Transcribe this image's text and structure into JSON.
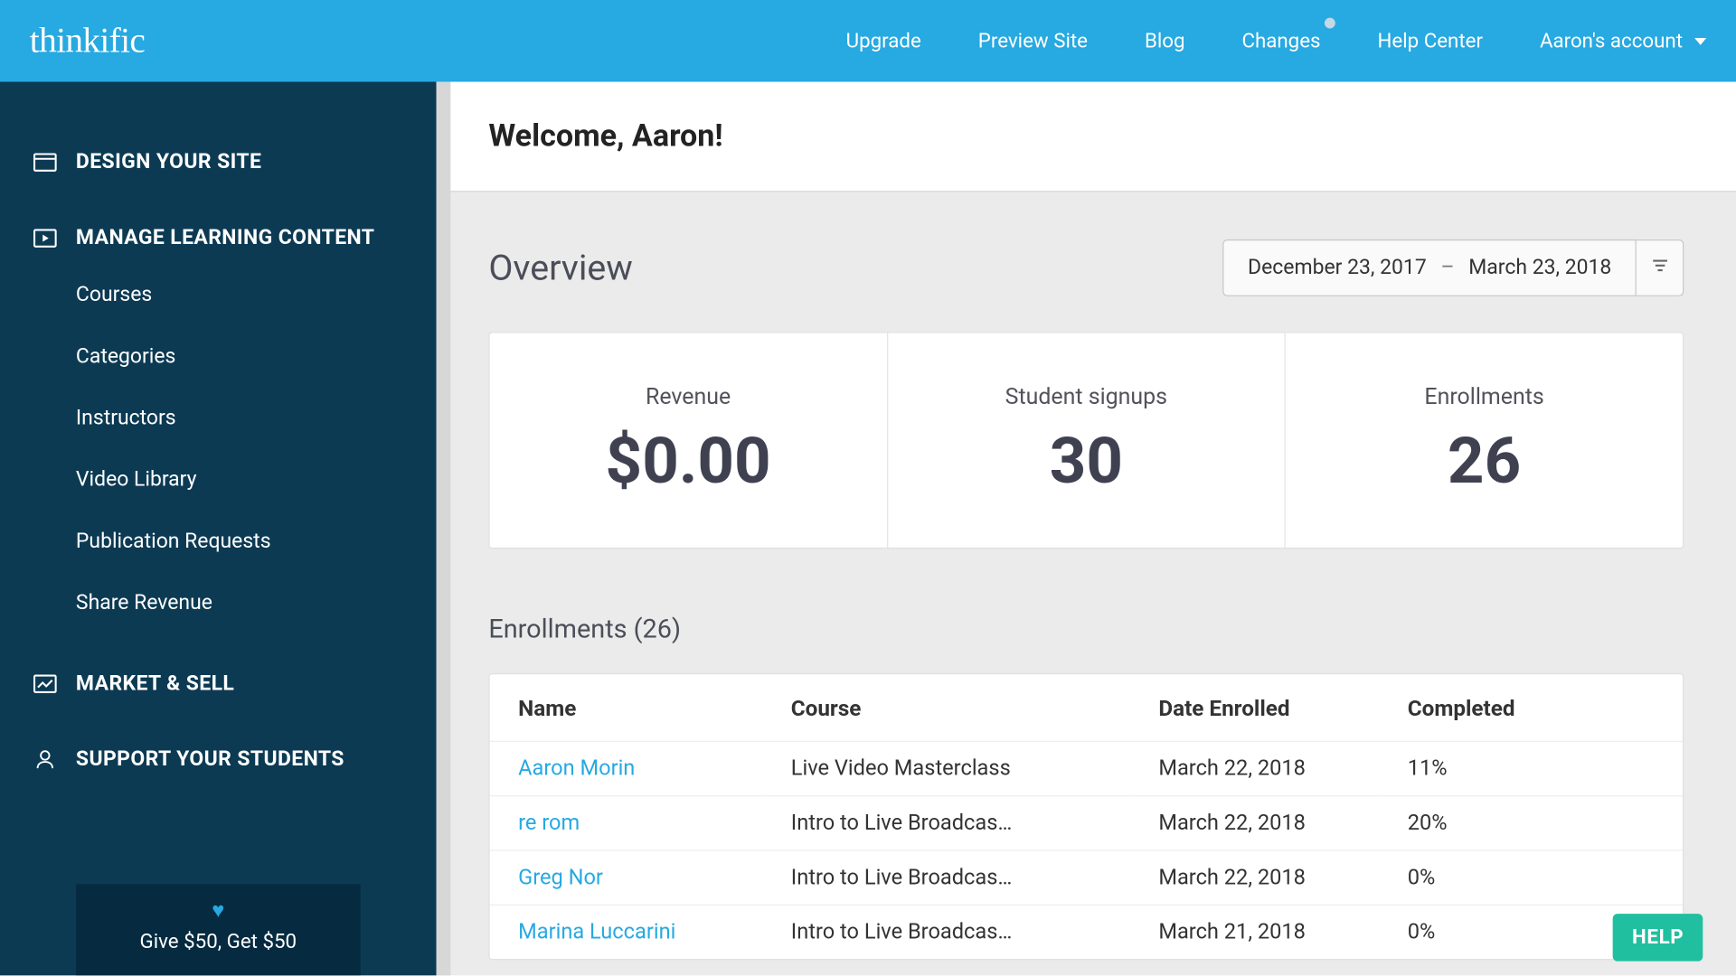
{
  "brand": "thinkific",
  "topnav": {
    "upgrade": "Upgrade",
    "preview": "Preview Site",
    "blog": "Blog",
    "changes": "Changes",
    "help": "Help Center",
    "account": "Aaron's account"
  },
  "sidebar": {
    "design": "DESIGN YOUR SITE",
    "manage": "MANAGE LEARNING CONTENT",
    "manage_items": {
      "courses": "Courses",
      "categories": "Categories",
      "instructors": "Instructors",
      "video_library": "Video Library",
      "publication_requests": "Publication Requests",
      "share_revenue": "Share Revenue"
    },
    "market": "MARKET & SELL",
    "support": "SUPPORT YOUR STUDENTS",
    "referral": "Give $50, Get $50"
  },
  "welcome": "Welcome, Aaron!",
  "overview": {
    "title": "Overview",
    "from": "December 23, 2017",
    "to": "March 23, 2018",
    "sep": "–"
  },
  "stats": {
    "revenue_label": "Revenue",
    "revenue_value": "$0.00",
    "signups_label": "Student signups",
    "signups_value": "30",
    "enrollments_label": "Enrollments",
    "enrollments_value": "26"
  },
  "enrollments": {
    "title": "Enrollments (26)",
    "headers": {
      "name": "Name",
      "course": "Course",
      "date": "Date Enrolled",
      "completed": "Completed"
    },
    "rows": [
      {
        "name": "Aaron Morin",
        "course": "Live Video Masterclass",
        "date": "March 22, 2018",
        "completed": "11%"
      },
      {
        "name": "re rom",
        "course": "Intro to Live Broadcas…",
        "date": "March 22, 2018",
        "completed": "20%"
      },
      {
        "name": "Greg Nor",
        "course": "Intro to Live Broadcas…",
        "date": "March 22, 2018",
        "completed": "0%"
      },
      {
        "name": "Marina Luccarini",
        "course": "Intro to Live Broadcas…",
        "date": "March 21, 2018",
        "completed": "0%"
      }
    ]
  },
  "help_button": "HELP"
}
